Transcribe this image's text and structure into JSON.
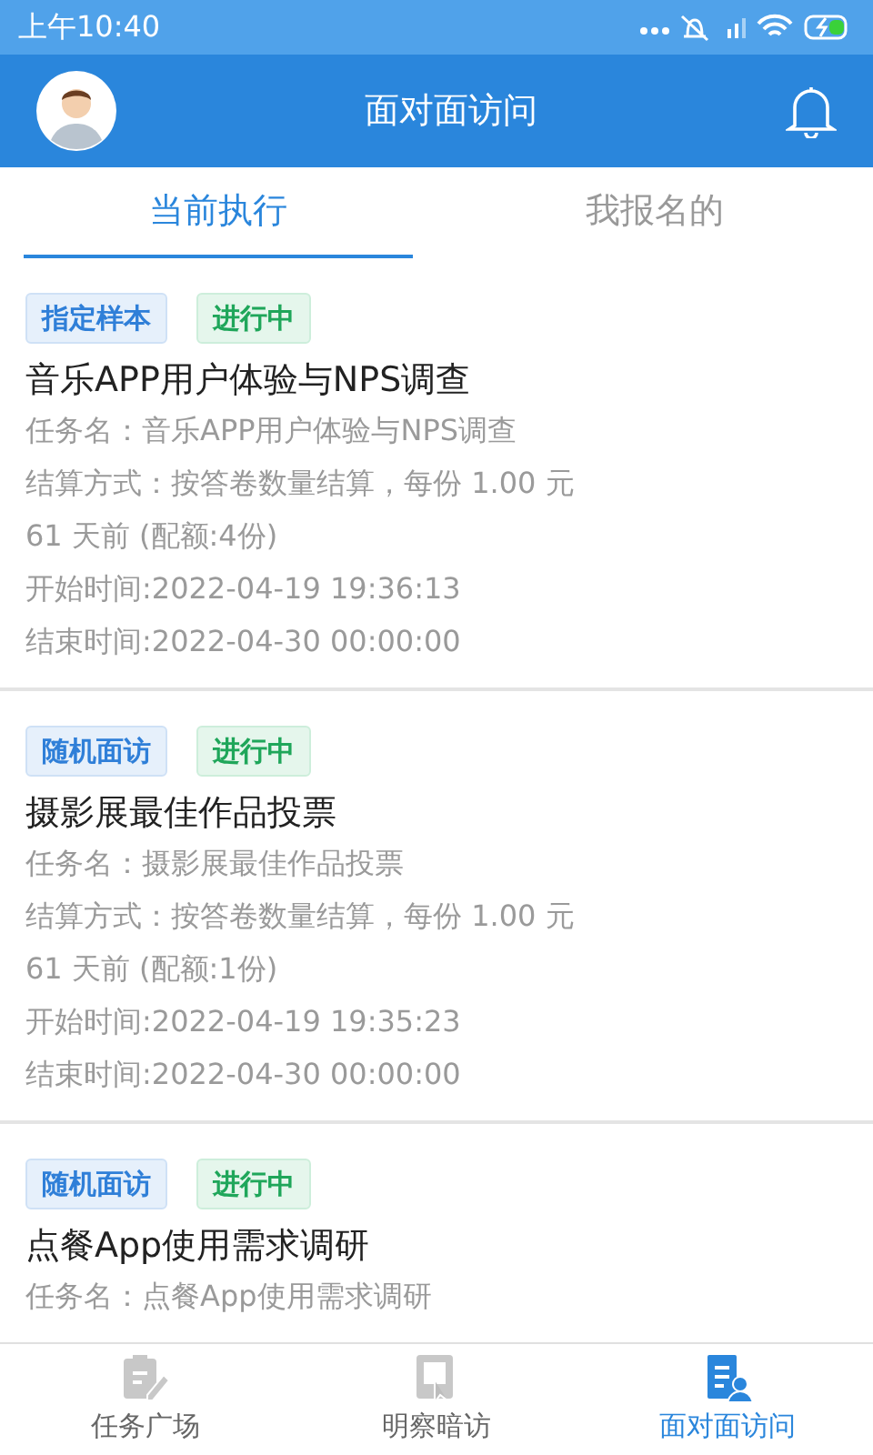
{
  "status_bar": {
    "time": "上午10:40"
  },
  "header": {
    "title": "面对面访问"
  },
  "tabs": [
    {
      "label": "当前执行",
      "selected": true
    },
    {
      "label": "我报名的",
      "selected": false
    }
  ],
  "tasks": [
    {
      "tags": [
        {
          "kind": "category",
          "text": "指定样本"
        },
        {
          "kind": "status",
          "text": "进行中"
        }
      ],
      "title": "音乐APP用户体验与NPS调查",
      "lines": [
        "任务名：音乐APP用户体验与NPS调查",
        "结算方式：按答卷数量结算，每份 1.00 元",
        "61 天前 (配额:4份)",
        "开始时间:2022-04-19 19:36:13",
        "结束时间:2022-04-30 00:00:00"
      ]
    },
    {
      "tags": [
        {
          "kind": "category",
          "text": "随机面访"
        },
        {
          "kind": "status",
          "text": "进行中"
        }
      ],
      "title": "摄影展最佳作品投票",
      "lines": [
        "任务名：摄影展最佳作品投票",
        "结算方式：按答卷数量结算，每份 1.00 元",
        "61 天前 (配额:1份)",
        "开始时间:2022-04-19 19:35:23",
        "结束时间:2022-04-30 00:00:00"
      ]
    },
    {
      "tags": [
        {
          "kind": "category",
          "text": "随机面访"
        },
        {
          "kind": "status",
          "text": "进行中"
        }
      ],
      "title": "点餐App使用需求调研",
      "lines": [
        "任务名：点餐App使用需求调研"
      ]
    }
  ],
  "bottom_nav": [
    {
      "kind": "tasks",
      "label": "任务广场",
      "selected": false
    },
    {
      "kind": "mystery",
      "label": "明察暗访",
      "selected": false
    },
    {
      "kind": "interview",
      "label": "面对面访问",
      "selected": true
    }
  ]
}
